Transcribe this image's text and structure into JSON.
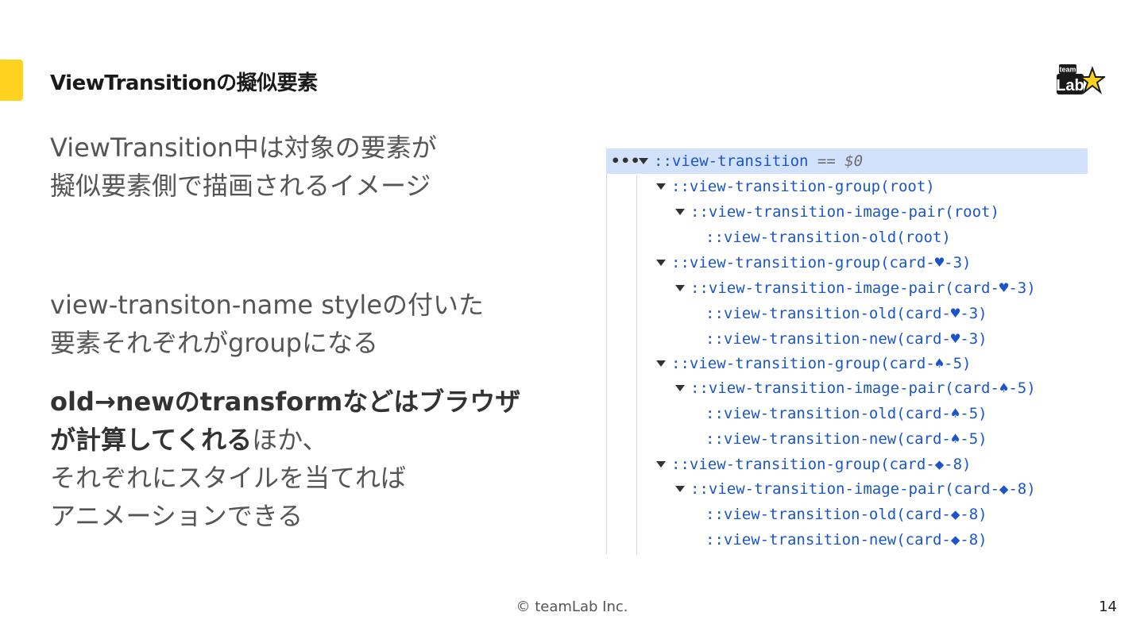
{
  "slide": {
    "title": "ViewTransitionの擬似要素",
    "accent_color": "#FFD21F",
    "page_number": "14",
    "copyright": "© teamLab Inc."
  },
  "logo": {
    "top_text": "team",
    "main_text": "Lab",
    "icon": "star-icon"
  },
  "left_text": {
    "block1": [
      "ViewTransition中は対象の要素が",
      "擬似要素側で描画されるイメージ"
    ],
    "block2": [
      "view-transiton-name styleの付いた",
      "要素それぞれがgroupになる"
    ],
    "block3_line1": "old→newのtransformなどはブラウザ",
    "block3_line2_bold": "が計算してくれる",
    "block3_line2_rest": "ほか、",
    "block3_line3": "それぞれにスタイルを当てれば",
    "block3_line4": "アニメーションできる"
  },
  "devtools": {
    "ellipsis": "•••",
    "selected_suffix": "== $0",
    "rows": [
      "::view-transition",
      "::view-transition-group(root)",
      "::view-transition-image-pair(root)",
      "::view-transition-old(root)",
      "::view-transition-group(card-♥-3)",
      "::view-transition-image-pair(card-♥-3)",
      "::view-transition-old(card-♥-3)",
      "::view-transition-new(card-♥-3)",
      "::view-transition-group(card-♠-5)",
      "::view-transition-image-pair(card-♠-5)",
      "::view-transition-old(card-♠-5)",
      "::view-transition-new(card-♠-5)",
      "::view-transition-group(card-◆-8)",
      "::view-transition-image-pair(card-◆-8)",
      "::view-transition-old(card-◆-8)",
      "::view-transition-new(card-◆-8)"
    ]
  }
}
